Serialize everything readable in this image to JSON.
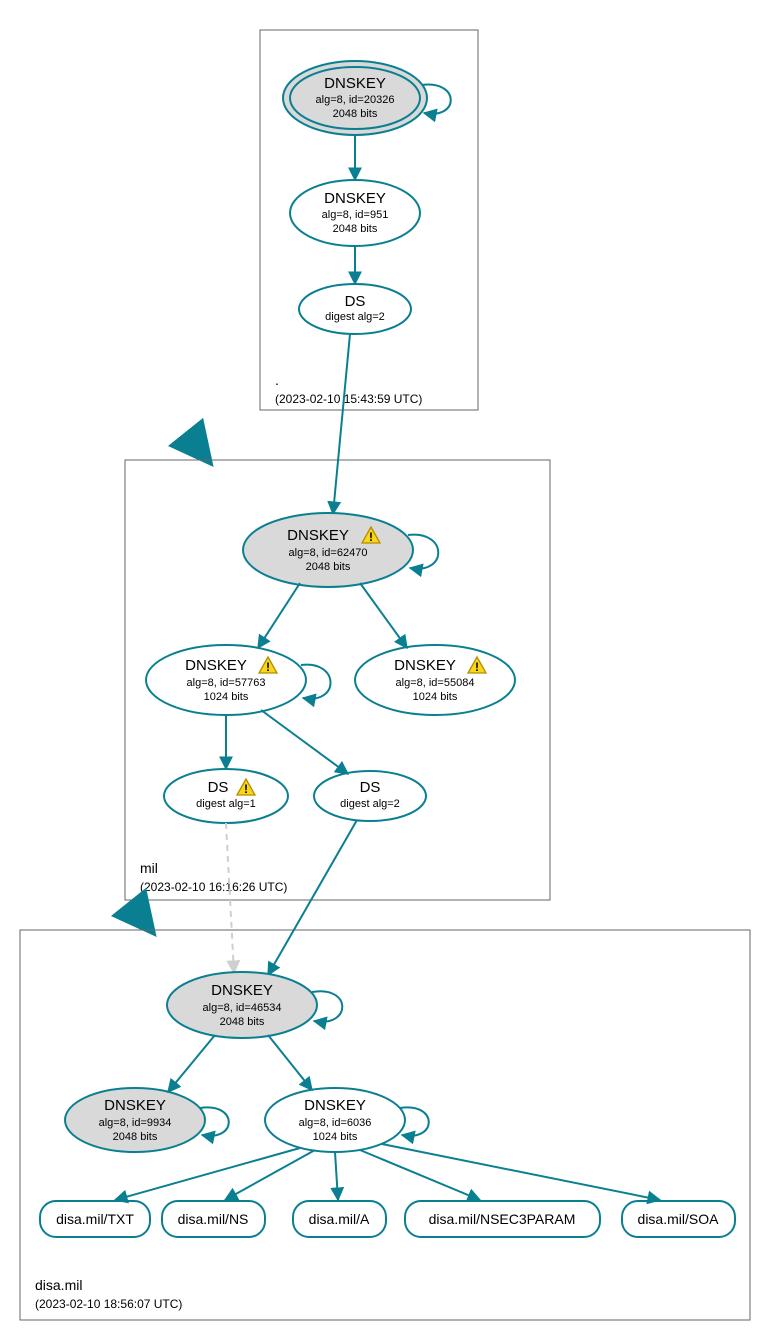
{
  "colors": {
    "stroke": "#0a7f91",
    "grey_fill": "#d9d9d9",
    "box_stroke": "#666666",
    "text": "#000000",
    "warn_fill": "#f7d717",
    "warn_stroke": "#b58d00",
    "dashed": "#cfcfcf"
  },
  "zones": {
    "root": {
      "label": ".",
      "timestamp": "(2023-02-10 15:43:59 UTC)"
    },
    "mil": {
      "label": "mil",
      "timestamp": "(2023-02-10 16:16:26 UTC)"
    },
    "disa": {
      "label": "disa.mil",
      "timestamp": "(2023-02-10 18:56:07 UTC)"
    }
  },
  "nodes": {
    "root_ksk": {
      "title": "DNSKEY",
      "l2": "alg=8, id=20326",
      "l3": "2048 bits",
      "warn": false,
      "fill": "grey",
      "double": true
    },
    "root_zsk": {
      "title": "DNSKEY",
      "l2": "alg=8, id=951",
      "l3": "2048 bits",
      "warn": false,
      "fill": "white",
      "double": false
    },
    "root_ds": {
      "title": "DS",
      "l2": "digest alg=2",
      "l3": "",
      "warn": false,
      "fill": "white",
      "double": false
    },
    "mil_ksk": {
      "title": "DNSKEY",
      "l2": "alg=8, id=62470",
      "l3": "2048 bits",
      "warn": true,
      "fill": "grey",
      "double": false
    },
    "mil_zsk1": {
      "title": "DNSKEY",
      "l2": "alg=8, id=57763",
      "l3": "1024 bits",
      "warn": true,
      "fill": "white",
      "double": false
    },
    "mil_zsk2": {
      "title": "DNSKEY",
      "l2": "alg=8, id=55084",
      "l3": "1024 bits",
      "warn": true,
      "fill": "white",
      "double": false
    },
    "mil_ds1": {
      "title": "DS",
      "l2": "digest alg=1",
      "l3": "",
      "warn": true,
      "fill": "white",
      "double": false
    },
    "mil_ds2": {
      "title": "DS",
      "l2": "digest alg=2",
      "l3": "",
      "warn": false,
      "fill": "white",
      "double": false
    },
    "disa_ksk": {
      "title": "DNSKEY",
      "l2": "alg=8, id=46534",
      "l3": "2048 bits",
      "warn": false,
      "fill": "grey",
      "double": false
    },
    "disa_key2": {
      "title": "DNSKEY",
      "l2": "alg=8, id=9934",
      "l3": "2048 bits",
      "warn": false,
      "fill": "grey",
      "double": false
    },
    "disa_zsk": {
      "title": "DNSKEY",
      "l2": "alg=8, id=6036",
      "l3": "1024 bits",
      "warn": false,
      "fill": "white",
      "double": false
    }
  },
  "records": {
    "r1": "disa.mil/TXT",
    "r2": "disa.mil/NS",
    "r3": "disa.mil/A",
    "r4": "disa.mil/NSEC3PARAM",
    "r5": "disa.mil/SOA"
  }
}
